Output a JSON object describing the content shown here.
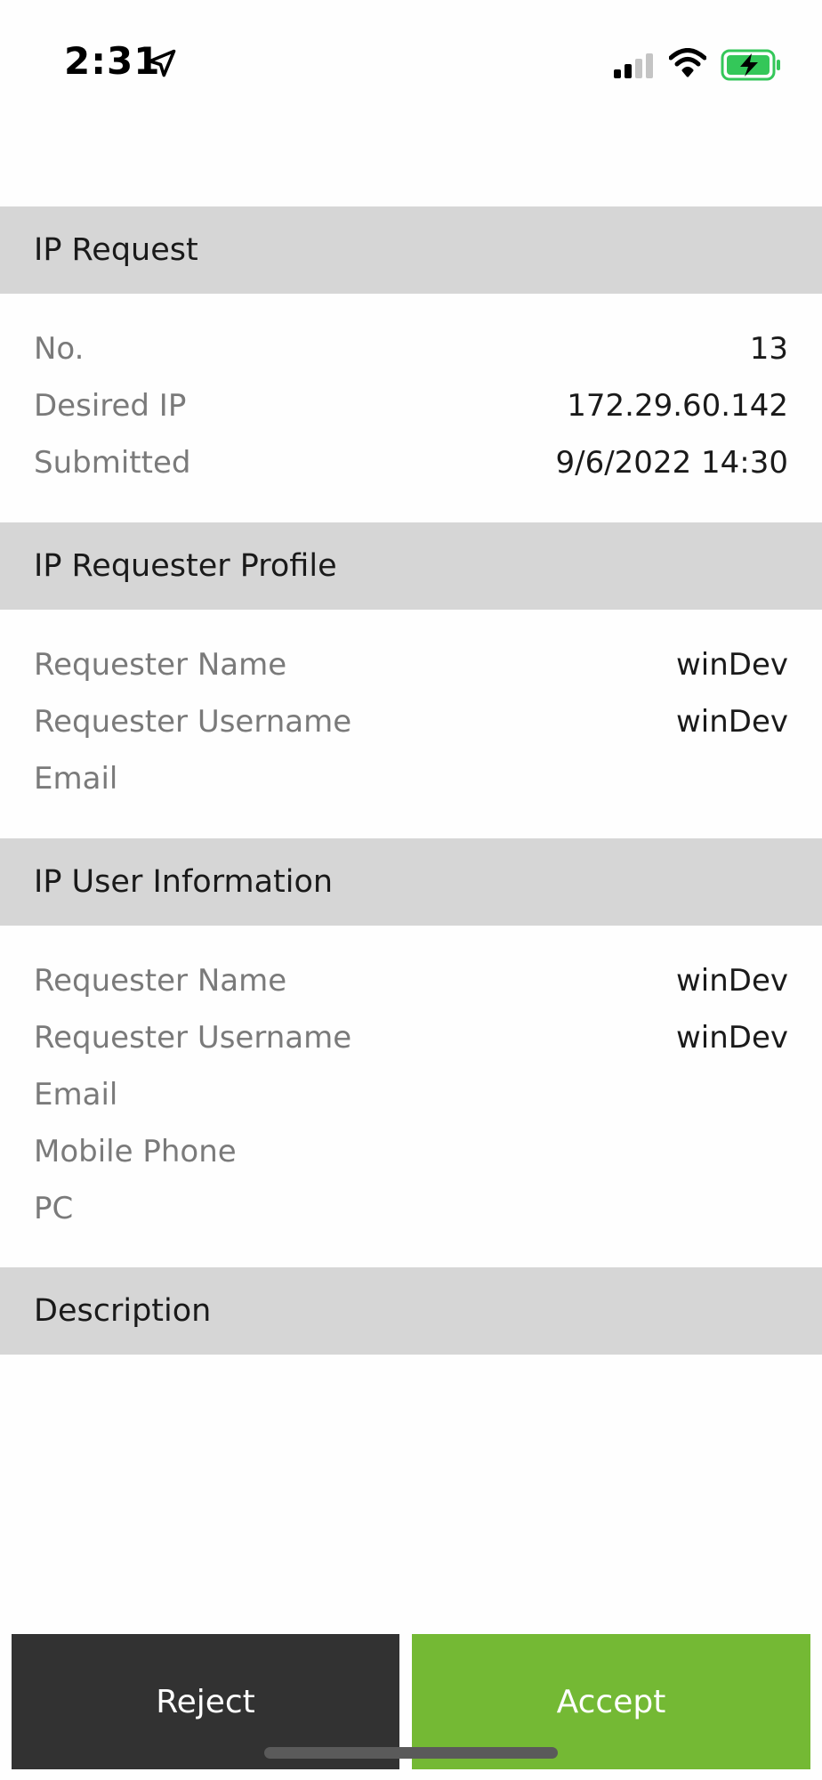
{
  "status_bar": {
    "time": "2:31",
    "icons": [
      "location-arrow-icon",
      "cellular-signal-icon",
      "wifi-icon",
      "battery-charging-icon"
    ],
    "battery_color": "#34c759"
  },
  "ip_request": {
    "title": "IP Request",
    "rows": [
      {
        "label": "No.",
        "value": "13"
      },
      {
        "label": "Desired IP",
        "value": "172.29.60.142"
      },
      {
        "label": "Submitted",
        "value": "9/6/2022 14:30"
      }
    ]
  },
  "requester_profile": {
    "title": "IP Requester Profile",
    "rows": [
      {
        "label": "Requester Name",
        "value": "winDev"
      },
      {
        "label": "Requester Username",
        "value": "winDev"
      },
      {
        "label": "Email",
        "value": ""
      }
    ]
  },
  "user_information": {
    "title": "IP User Information",
    "rows": [
      {
        "label": "Requester Name",
        "value": "winDev"
      },
      {
        "label": "Requester Username",
        "value": "winDev"
      },
      {
        "label": "Email",
        "value": ""
      },
      {
        "label": "Mobile Phone",
        "value": ""
      },
      {
        "label": "PC",
        "value": ""
      }
    ]
  },
  "description": {
    "title": "Description",
    "text": ""
  },
  "actions": {
    "reject_label": "Reject",
    "accept_label": "Accept",
    "reject_color": "#323232",
    "accept_color": "#74b934"
  }
}
